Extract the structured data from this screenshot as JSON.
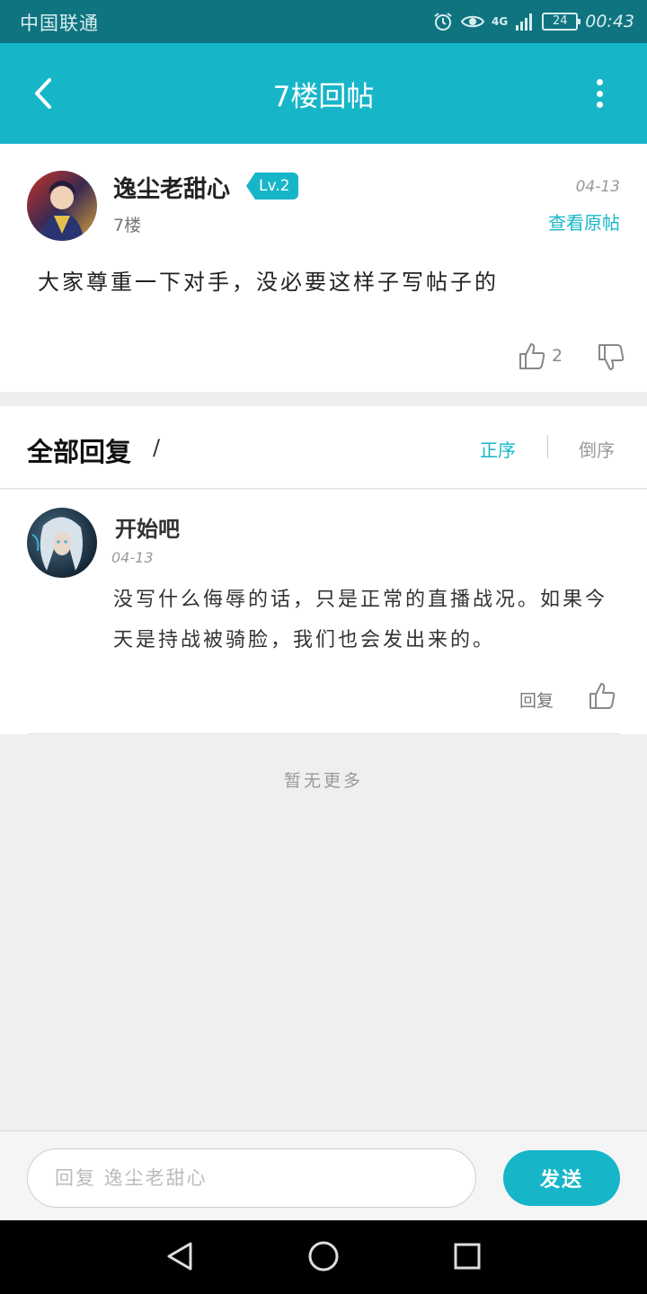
{
  "status_bar": {
    "carrier": "中国联通",
    "network": "4G",
    "battery": "24",
    "time": "00:43"
  },
  "header": {
    "title": "7楼回帖"
  },
  "post": {
    "author": "逸尘老甜心",
    "level": "Lv.2",
    "date": "04-13",
    "floor": "7楼",
    "view_original": "查看原帖",
    "content": "大家尊重一下对手，没必要这样子写帖子的",
    "likes": "2"
  },
  "replies_section": {
    "title": "全部回复",
    "slash": "/",
    "sort_asc": "正序",
    "sort_desc": "倒序"
  },
  "replies": [
    {
      "author": "开始吧",
      "date": "04-13",
      "content": "没写什么侮辱的话，只是正常的直播战况。如果今天是持战被骑脸，我们也会发出来的。",
      "reply_label": "回复"
    }
  ],
  "footer_note": "暂无更多",
  "input": {
    "placeholder": "回复 逸尘老甜心",
    "send_label": "发送"
  },
  "colors": {
    "accent": "#16b6c8",
    "status_bar": "#0f7480"
  }
}
